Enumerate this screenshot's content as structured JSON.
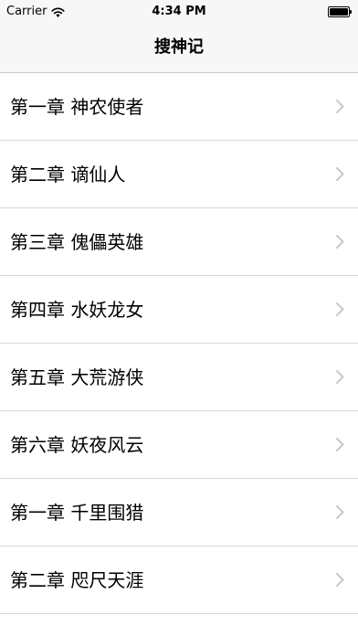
{
  "status_bar": {
    "carrier": "Carrier",
    "time": "4:34 PM",
    "wifi_icon": "wifi-icon",
    "battery_icon": "battery-icon",
    "battery_level": 1.0
  },
  "nav": {
    "title": "搜神记"
  },
  "colors": {
    "bar_background": "#f7f7f7",
    "separator": "#d8d8dc",
    "chevron": "#c7c7cc"
  },
  "chapters": [
    {
      "title": "第一章 神农使者",
      "icon": "chevron-right-icon"
    },
    {
      "title": "第二章 谪仙人",
      "icon": "chevron-right-icon"
    },
    {
      "title": "第三章 傀儡英雄",
      "icon": "chevron-right-icon"
    },
    {
      "title": "第四章 水妖龙女",
      "icon": "chevron-right-icon"
    },
    {
      "title": "第五章 大荒游侠",
      "icon": "chevron-right-icon"
    },
    {
      "title": "第六章 妖夜风云",
      "icon": "chevron-right-icon"
    },
    {
      "title": "第一章 千里围猎",
      "icon": "chevron-right-icon"
    },
    {
      "title": "第二章 咫尺天涯",
      "icon": "chevron-right-icon"
    }
  ]
}
